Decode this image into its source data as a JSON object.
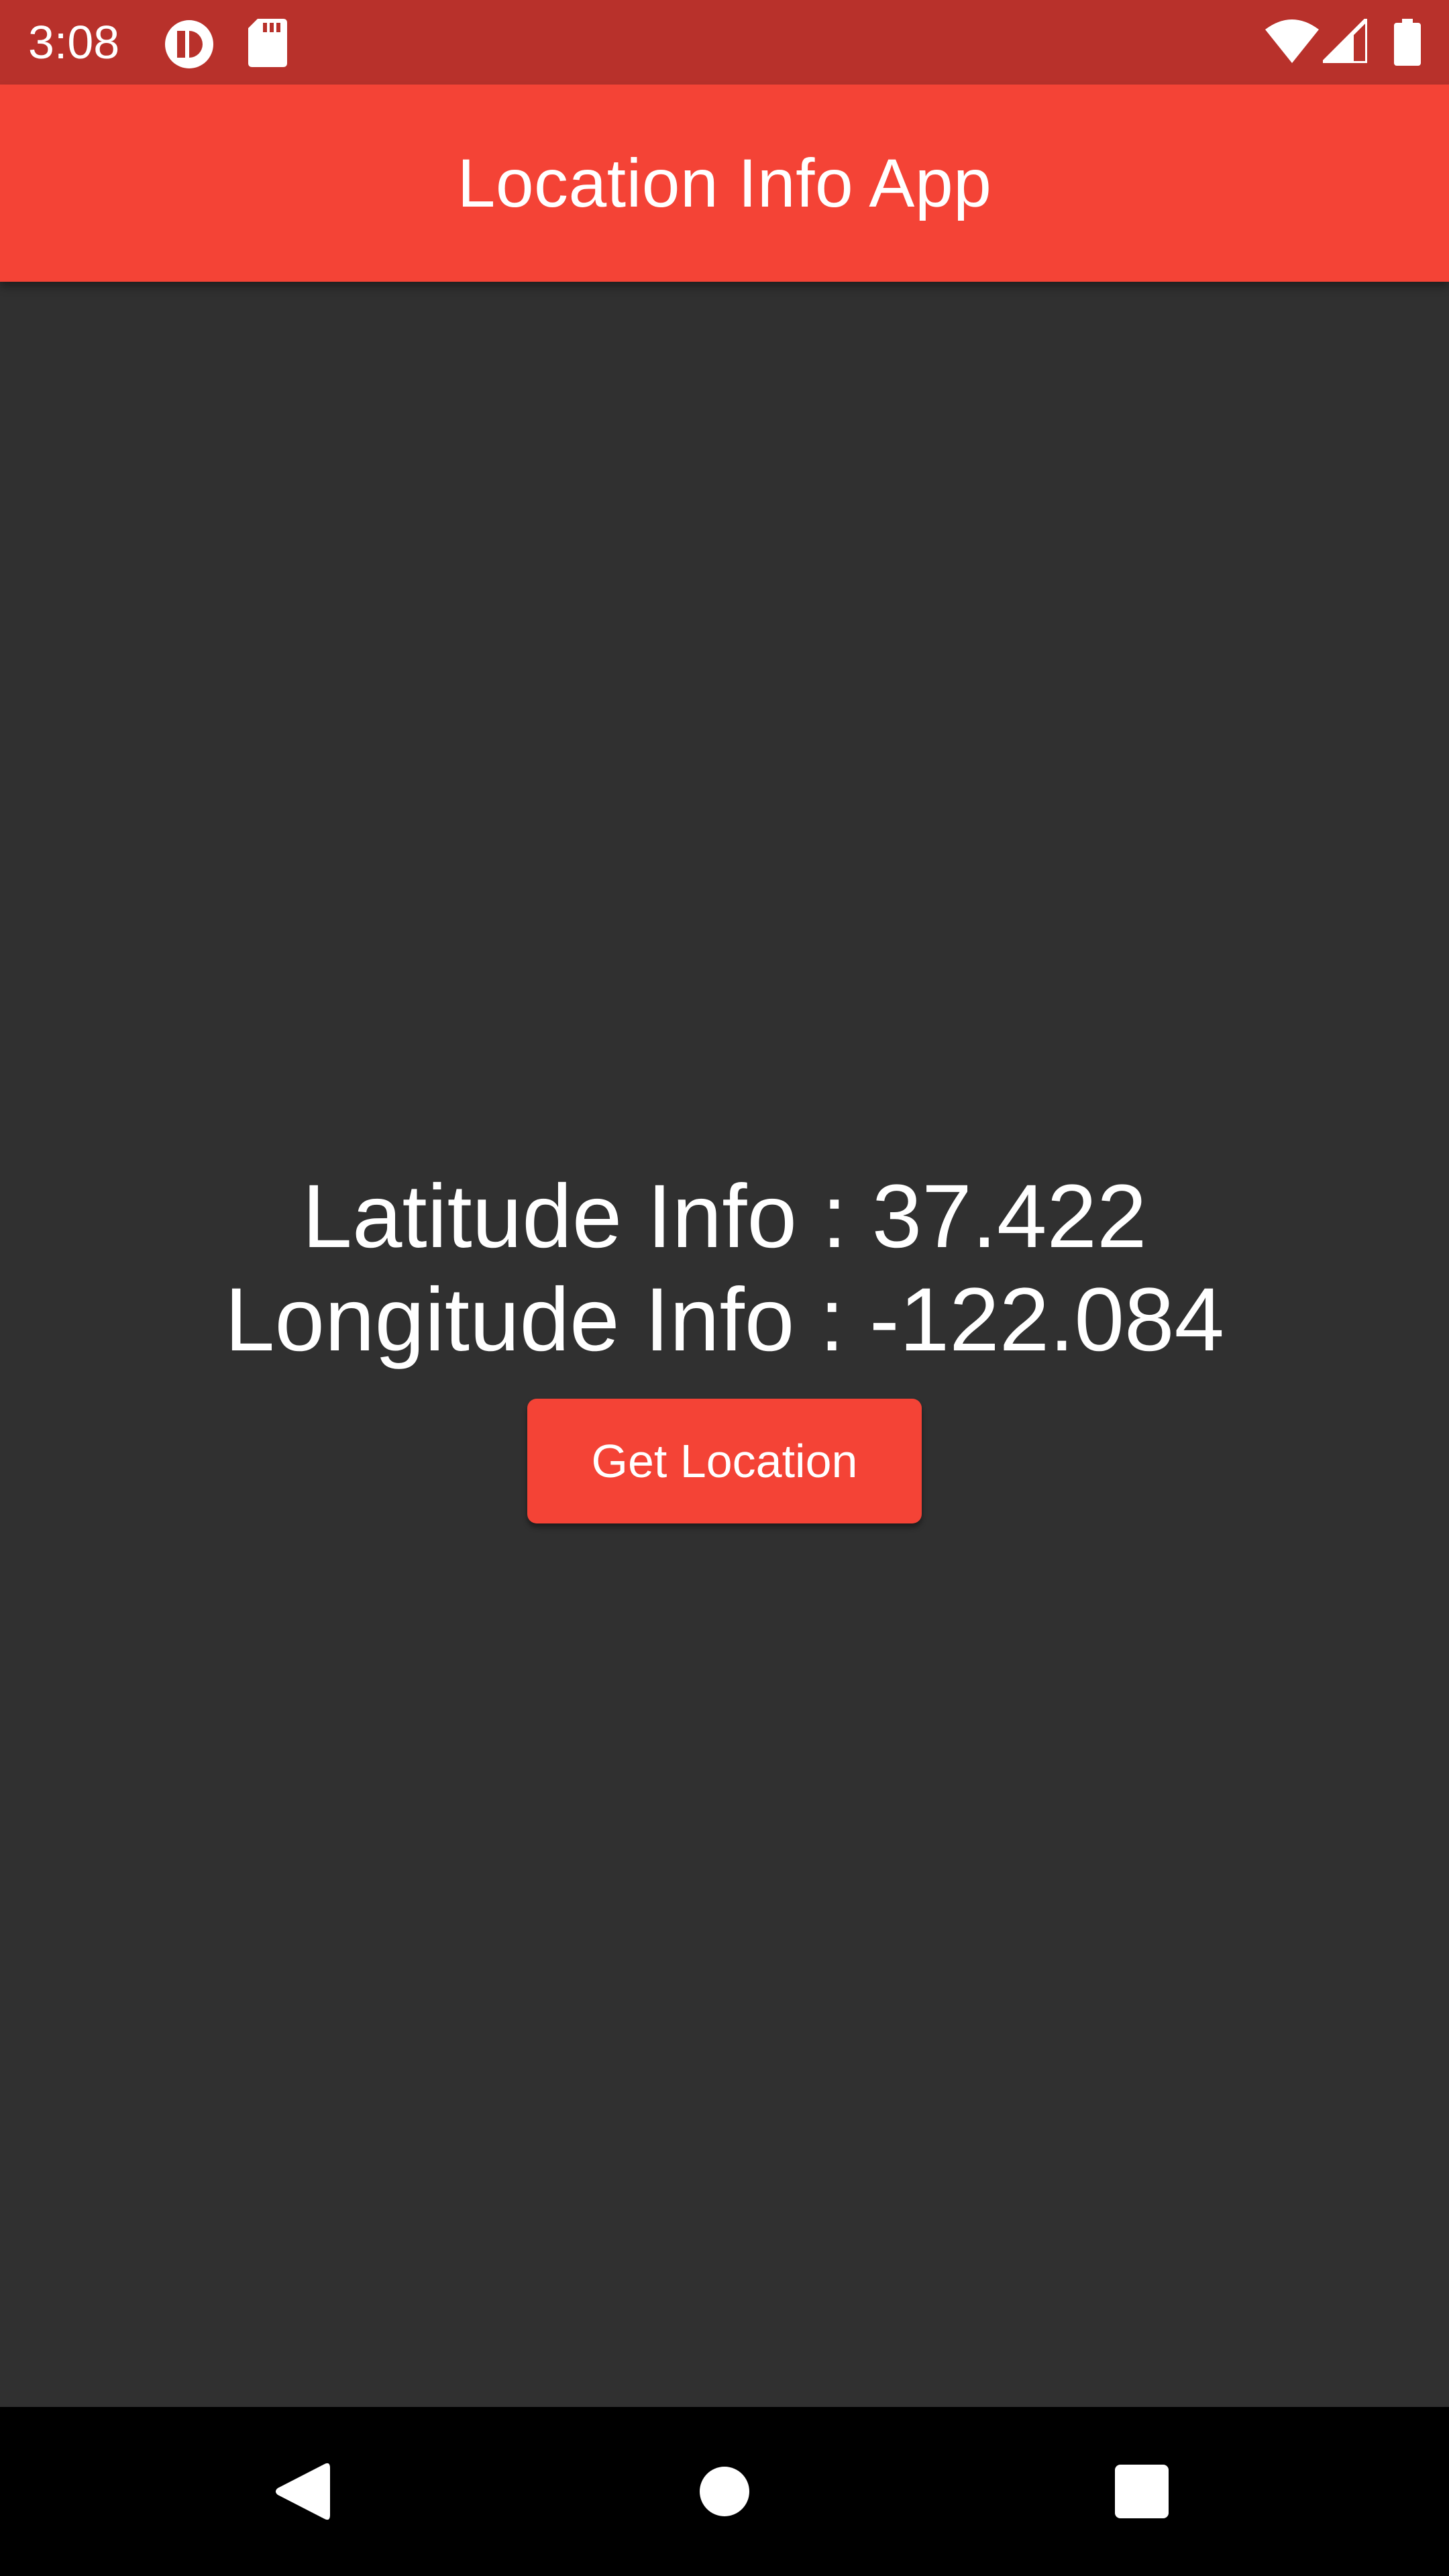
{
  "status_bar": {
    "time": "3:08",
    "left_icons": [
      "app-notification-icon",
      "sd-card-icon"
    ],
    "right_icons": [
      "wifi-icon",
      "cell-signal-icon",
      "battery-icon"
    ],
    "background_color": "#b8312b"
  },
  "app_bar": {
    "title": "Location Info App",
    "background_color": "#f44336"
  },
  "main": {
    "latitude_text": "Latitude Info : 37.422",
    "longitude_text": "Longitude Info : -122.084",
    "button_label": "Get Location",
    "background_color": "#303030"
  },
  "nav_bar": {
    "buttons": [
      "back-icon",
      "home-icon",
      "recents-icon"
    ]
  }
}
